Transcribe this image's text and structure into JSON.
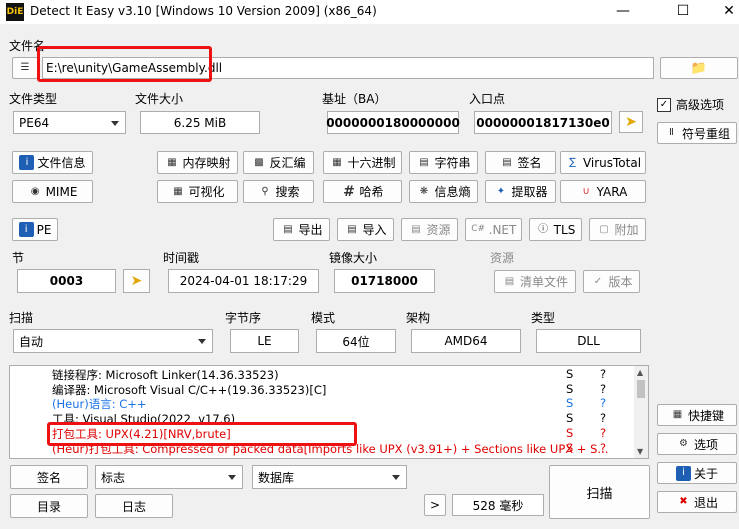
{
  "window": {
    "title": "Detect It Easy v3.10 [Windows 10 Version 2009] (x86_64)",
    "app_icon": "DiE"
  },
  "file": {
    "label": "文件名",
    "path": "E:\\re\\unity\\GameAssembly.dll"
  },
  "info": {
    "file_type_label": "文件类型",
    "file_type_value": "PE64",
    "file_size_label": "文件大小",
    "file_size_value": "6.25 MiB",
    "base_addr_label": "基址（BA）",
    "base_addr_value": "0000000180000000",
    "entry_point_label": "入口点",
    "entry_point_value": "00000001817130e0"
  },
  "right_panel": {
    "advanced": "高级选项",
    "demangle": "符号重组",
    "shortcuts": "快捷键",
    "options": "选项",
    "about": "关于",
    "exit": "退出"
  },
  "tools_row1": [
    "文件信息",
    "内存映射",
    "反汇编",
    "十六进制",
    "字符串",
    "签名",
    "VirusTotal"
  ],
  "tools_row2": [
    "MIME",
    "可视化",
    "搜索",
    "哈希",
    "信息熵",
    "提取器",
    "YARA"
  ],
  "pe": {
    "pe_button": "PE",
    "export": "导出",
    "import": "导入",
    "resources": "资源",
    "net": ".NET",
    "tls": "TLS",
    "overlay": "附加",
    "section_label": "节",
    "section_value": "0003",
    "timestamp_label": "时间戳",
    "timestamp_value": "2024-04-01 18:17:29",
    "image_size_label": "镜像大小",
    "image_size_value": "01718000",
    "resources_label": "资源",
    "manifest": "清单文件",
    "version": "版本"
  },
  "scan": {
    "scan_label": "扫描",
    "scan_mode": "自动",
    "endianness_label": "字节序",
    "endianness_value": "LE",
    "mode_label": "模式",
    "mode_value": "64位",
    "arch_label": "架构",
    "arch_value": "AMD64",
    "type_label": "类型",
    "type_value": "DLL",
    "results": [
      {
        "text": "链接程序: Microsoft Linker(14.36.33523)",
        "s": "S",
        "q": "?",
        "color": "#000000"
      },
      {
        "text": "编译器: Microsoft Visual C/C++(19.36.33523)[C]",
        "s": "S",
        "q": "?",
        "color": "#000000"
      },
      {
        "text": "(Heur)语言: C++",
        "s": "S",
        "q": "?",
        "color": "#1a73e8"
      },
      {
        "text": "工具: Visual Studio(2022, v17.6)",
        "s": "S",
        "q": "?",
        "color": "#000000"
      },
      {
        "text": "打包工具: UPX(4.21)[NRV,brute]",
        "s": "S",
        "q": "?",
        "color": "#e00000"
      },
      {
        "text": "(Heur)打包工具: Compressed or packed data[Imports like UPX (v3.91+) + Sections like UPX + S...",
        "s": "S",
        "q": "?",
        "color": "#e00000"
      }
    ]
  },
  "bottom": {
    "signatures": "签名",
    "flags": "标志",
    "database": "数据库",
    "directory": "目录",
    "log": "日志",
    "more": ">",
    "elapsed": "528 毫秒",
    "scan": "扫描"
  }
}
